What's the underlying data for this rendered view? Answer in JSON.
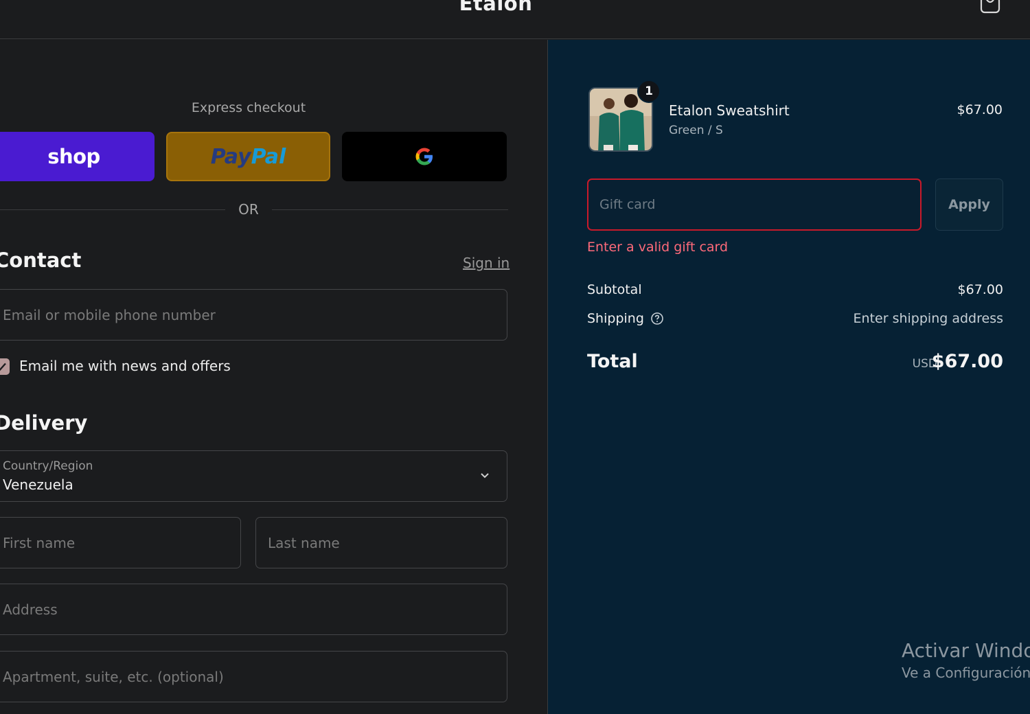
{
  "header": {
    "brand": "Etalon",
    "cart_icon": "shopping-bag-icon"
  },
  "express": {
    "label": "Express checkout",
    "shop_label": "shop",
    "paypal_pay": "Pay",
    "paypal_pal": "Pal",
    "google_icon": "google-g-icon",
    "colors": {
      "shop": "#4a1bd1",
      "paypal": "#8a5f05",
      "google": "#000000"
    }
  },
  "divider": {
    "or": "OR"
  },
  "contact": {
    "title": "Contact",
    "sign_in": "Sign in",
    "email_placeholder": "Email or mobile phone number",
    "news_label": "Email me with news and offers",
    "news_checked": true
  },
  "delivery": {
    "title": "Delivery",
    "country_label": "Country/Region",
    "country_value": "Venezuela",
    "first_name_placeholder": "First name",
    "last_name_placeholder": "Last name",
    "address_placeholder": "Address",
    "apartment_placeholder": "Apartment, suite, etc. (optional)"
  },
  "summary": {
    "item": {
      "quantity": "1",
      "name": "Etalon Sweatshirt",
      "variant": "Green / S",
      "price": "$67.00"
    },
    "gift": {
      "placeholder": "Gift card",
      "apply": "Apply",
      "error": "Enter a valid gift card",
      "error_color": "#c91a2a"
    },
    "subtotal_label": "Subtotal",
    "subtotal_value": "$67.00",
    "shipping_label": "Shipping",
    "shipping_value": "Enter shipping address",
    "total_label": "Total",
    "total_currency": "USD",
    "total_value": "$67.00"
  },
  "watermark": {
    "line1": "Activar Windo",
    "line2": "Ve a Configuración"
  },
  "theme": {
    "left_bg": "#1b1c1e",
    "right_bg": "#062134"
  }
}
